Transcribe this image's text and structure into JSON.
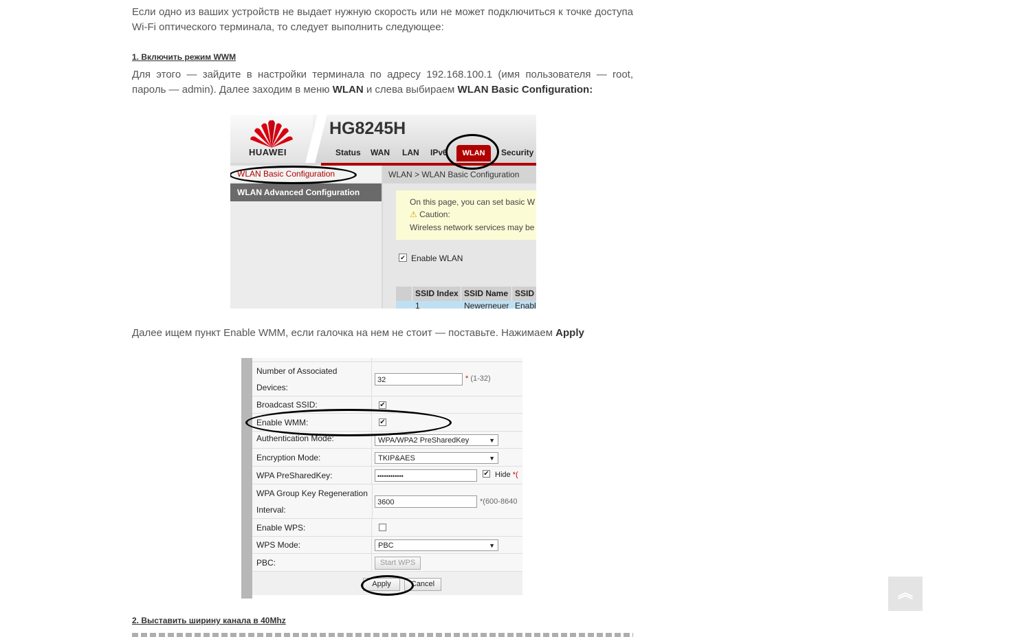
{
  "article": {
    "intro": "Если одно из ваших устройств не выдает нужную скорость или не может подключиться к точке доступа Wi-Fi оптического терминала, то следует выполнить следующее:",
    "step1_heading": "1. Включить режим WWM",
    "step1_text_a": "Для этого — зайдите в настройки терминала по адресу 192.168.100.1 (имя пользователя — root, пароль — admin). Далее заходим в меню ",
    "step1_bold_wlan": "WLAN",
    "step1_text_b": " и слева выбираем ",
    "step1_bold_basic": "WLAN Basic Configuration:",
    "step1_text_c": "Далее ищем пункт Enable WMM, если галочка на нем не стоит — поставьте. Нажимаем ",
    "step1_bold_apply": "Apply",
    "step2_heading": "2. Выставить ширину канала в 40Mhz"
  },
  "router_ui": {
    "brand": "HUAWEI",
    "model": "HG8245H",
    "nav": [
      "Status",
      "WAN",
      "LAN",
      "IPv6",
      "WLAN",
      "Security"
    ],
    "sidebar": [
      "WLAN Basic Configuration",
      "WLAN Advanced Configuration"
    ],
    "breadcrumb": "WLAN > WLAN Basic Configuration",
    "note_line1": "On this page, you can set basic W",
    "note_caution": "Caution:",
    "note_line3": "Wireless network services may be",
    "enable_wlan": "Enable WLAN",
    "table_headers": [
      "SSID Index",
      "SSID Name",
      "SSID"
    ],
    "table_row": [
      "1",
      "Newerneuer",
      "Enabl"
    ]
  },
  "wlan_form": {
    "rows": {
      "assoc_label_1": "Number of Associated",
      "assoc_label_2": "Devices:",
      "assoc_value": "32",
      "assoc_hint": "(1-32)",
      "broadcast_label": "Broadcast SSID:",
      "wmm_label": "Enable WMM:",
      "auth_label": "Authentication Mode:",
      "auth_value": "WPA/WPA2 PreSharedKey",
      "enc_label": "Encryption Mode:",
      "enc_value": "TKIP&AES",
      "psk_label": "WPA PreSharedKey:",
      "psk_value": "••••••••••••",
      "psk_hide": "Hide",
      "psk_hint": "*(",
      "regen_label_1": "WPA Group Key Regeneration",
      "regen_label_2": "Interval:",
      "regen_value": "3600",
      "regen_hint": "*(600-8640",
      "wps_label": "Enable WPS:",
      "wps_mode_label": "WPS Mode:",
      "wps_mode_value": "PBC",
      "pbc_label": "PBC:",
      "start_wps": "Start WPS",
      "apply": "Apply",
      "cancel": "Cancel"
    },
    "star": "*"
  },
  "scroll_top_icon": "double-chevron-up-icon",
  "scroll_top_glyph": "︽",
  "colors": {
    "huawei_red": "#b00000",
    "note_yellow": "#fbfbd6"
  }
}
